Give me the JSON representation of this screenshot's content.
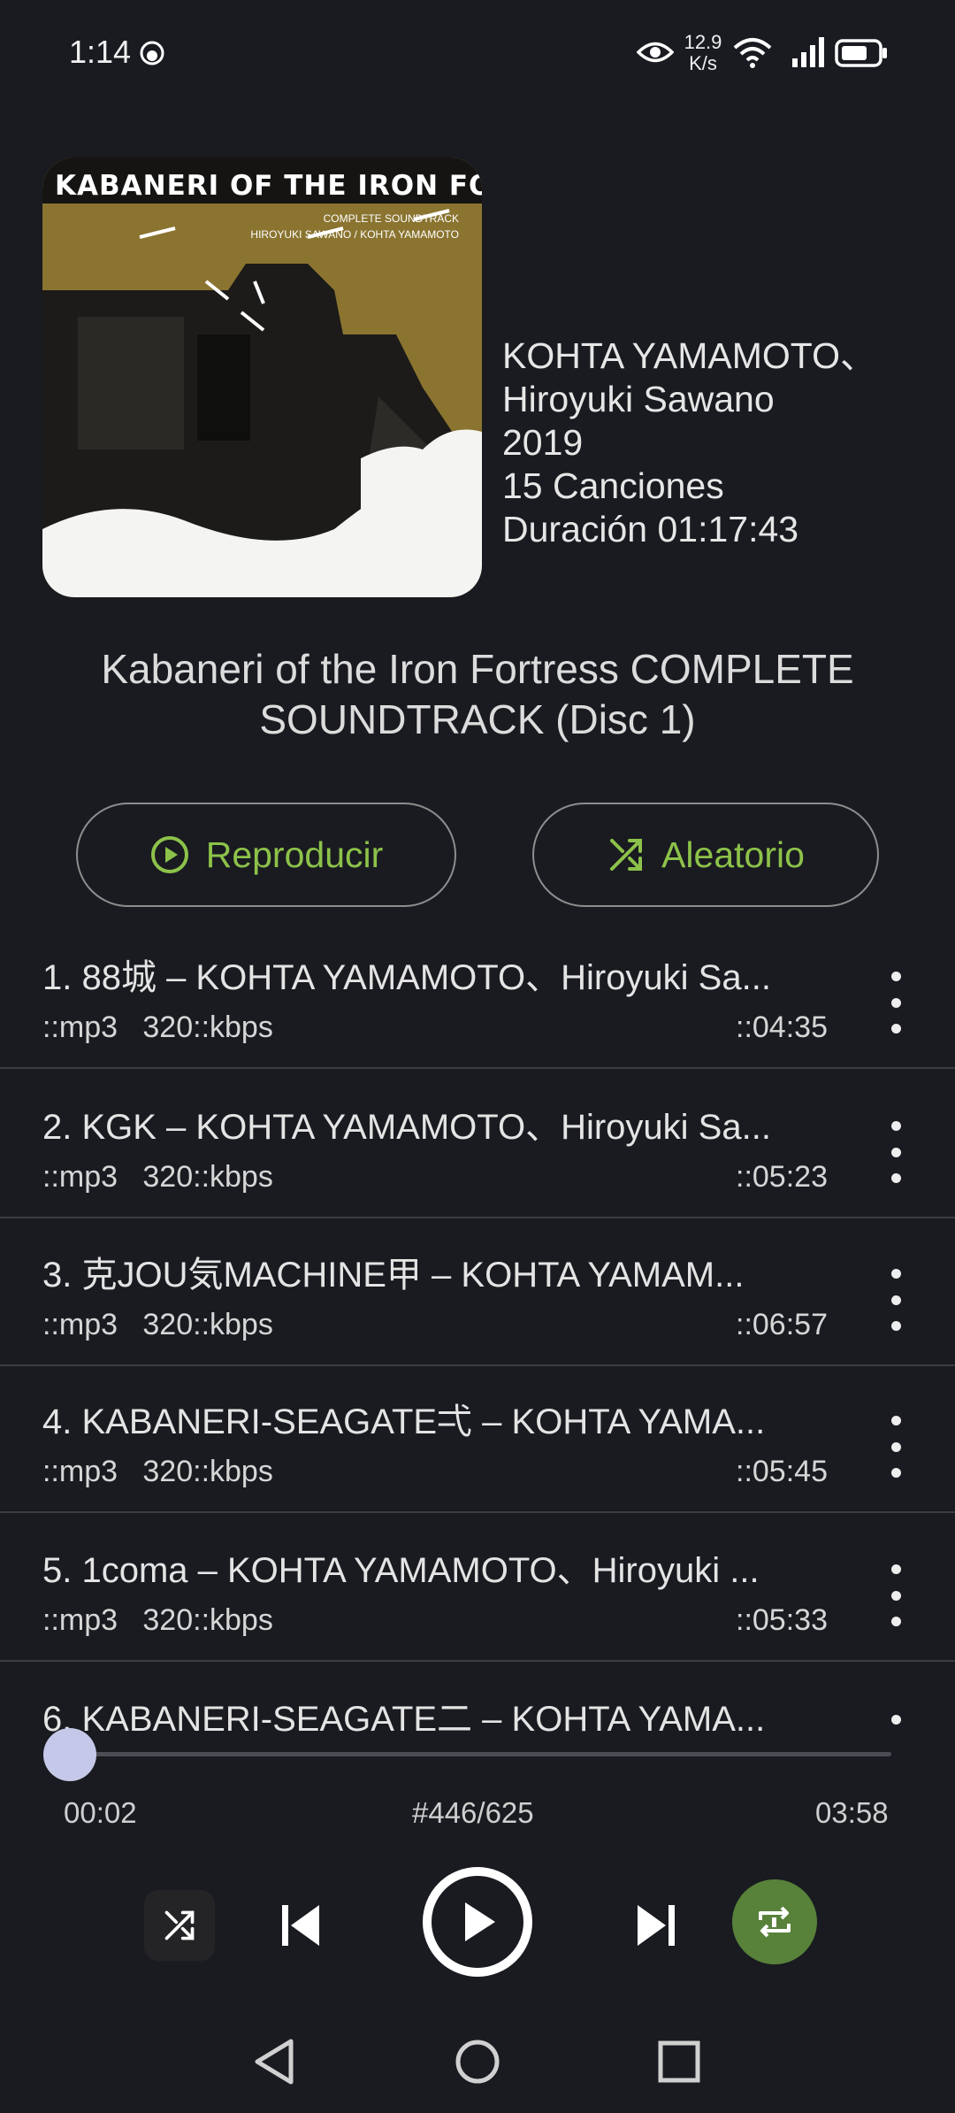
{
  "status_bar": {
    "time": "1:14",
    "net_speed_value": "12.9",
    "net_speed_unit": "K/s",
    "icons": [
      "notification-face-icon",
      "eye-icon",
      "wifi-icon",
      "signal-icon",
      "battery-icon"
    ]
  },
  "album": {
    "cover_title": "KABANERI OF THE IRON FORTRESS",
    "cover_subtitle": "COMPLETE SOUNDTRACK",
    "cover_artists": "HIROYUKI SAWANO / KOHTA YAMAMOTO",
    "artist_line1": "KOHTA YAMAMOTO、",
    "artist_line2": "Hiroyuki Sawano",
    "year": "2019",
    "songs": "15 Canciones",
    "duration": "Duración 01:17:43",
    "title": "Kabaneri of the Iron Fortress COMPLETE SOUNDTRACK (Disc 1)"
  },
  "actions": {
    "play_label": "Reproducir",
    "shuffle_label": "Aleatorio"
  },
  "tracks": [
    {
      "title": "1. 88城 – KOHTA YAMAMOTO、Hiroyuki Sa...",
      "format": "::mp3",
      "bitrate": "320::kbps",
      "duration": "::04:35"
    },
    {
      "title": "2. KGK – KOHTA YAMAMOTO、Hiroyuki Sa...",
      "format": "::mp3",
      "bitrate": "320::kbps",
      "duration": "::05:23"
    },
    {
      "title": "3. 克JOU気MACHINE甲 – KOHTA YAMAM...",
      "format": "::mp3",
      "bitrate": "320::kbps",
      "duration": "::06:57"
    },
    {
      "title": "4. KABANERI-SEAGATE弌 – KOHTA YAMA...",
      "format": "::mp3",
      "bitrate": "320::kbps",
      "duration": "::05:45"
    },
    {
      "title": "5. 1coma – KOHTA YAMAMOTO、Hiroyuki ...",
      "format": "::mp3",
      "bitrate": "320::kbps",
      "duration": "::05:33"
    },
    {
      "title": "6. KABANERI-SEAGATE二 – KOHTA YAMA...",
      "format": "",
      "bitrate": "",
      "duration": ""
    }
  ],
  "player": {
    "position": "00:02",
    "counter": "#446/625",
    "total": "03:58",
    "progress_fraction": 0.01
  },
  "colors": {
    "background": "#191b20",
    "accent_green": "#8dc24a",
    "repeat_bg": "#58813a",
    "seek_thumb": "#c5c8e8"
  }
}
